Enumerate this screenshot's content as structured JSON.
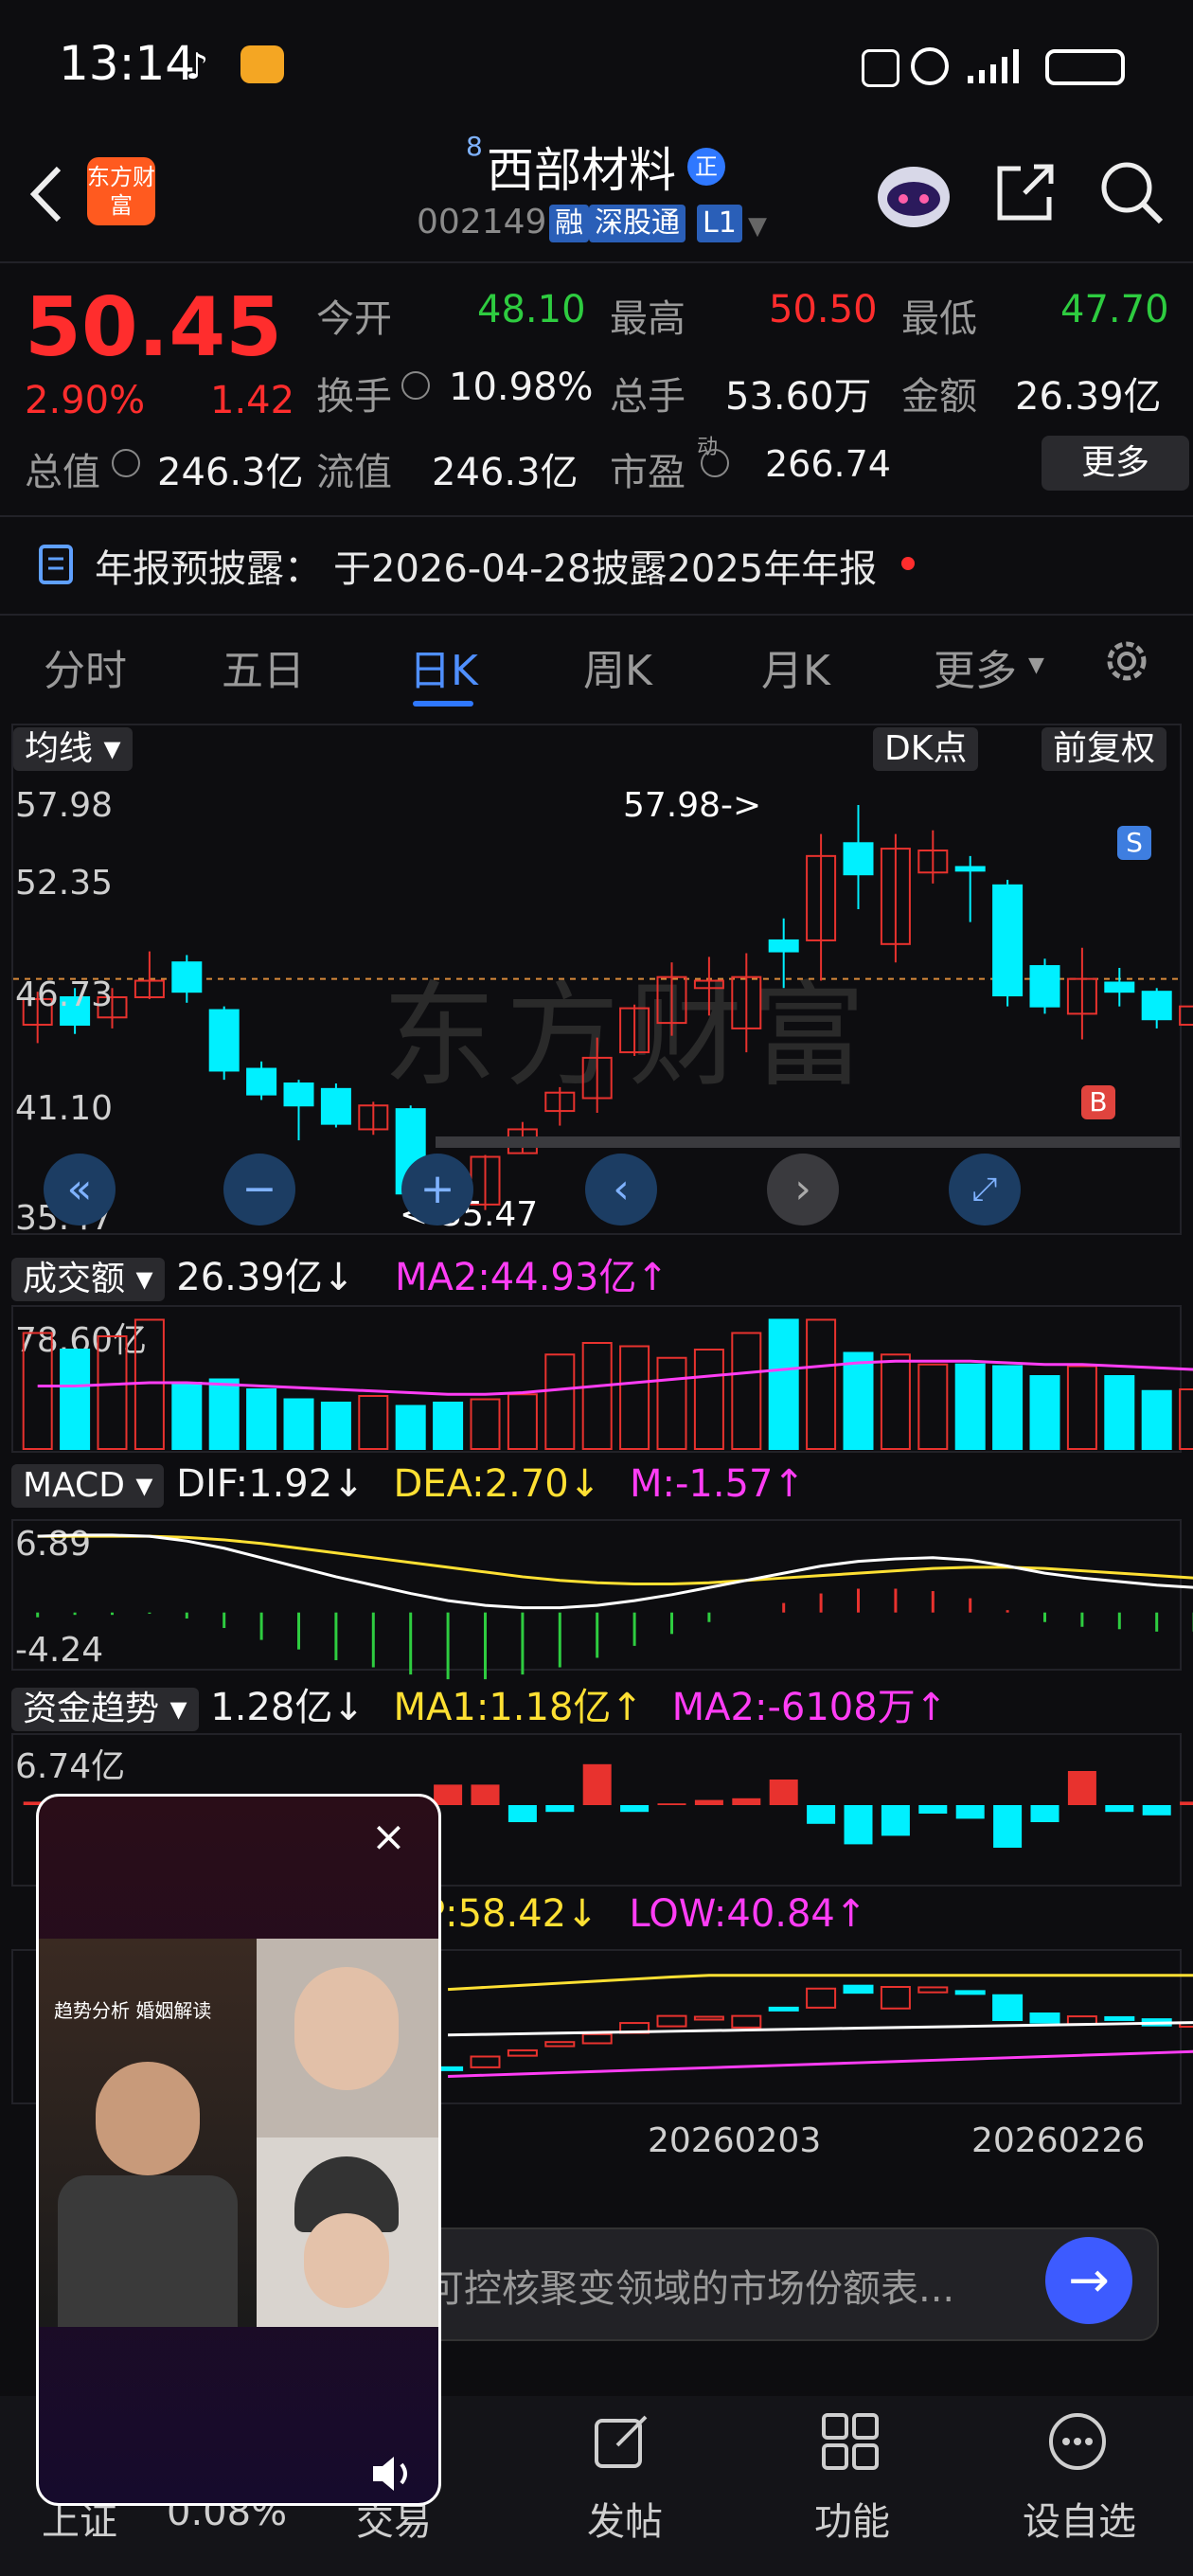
{
  "status_bar": {
    "time": "13:14"
  },
  "header": {
    "stock_name": "西部材料",
    "name_superscript": "8",
    "name_badge": "正",
    "stock_code": "002149",
    "tags": [
      "融",
      "深股通",
      "L1"
    ],
    "logo_text": "东方财富"
  },
  "quote": {
    "price": "50.45",
    "change_pct": "2.90%",
    "change": "1.42",
    "rows": [
      [
        {
          "label": "今开",
          "value": "48.10",
          "color": "green"
        },
        {
          "label": "最高",
          "value": "50.50",
          "color": "red"
        },
        {
          "label": "最低",
          "value": "47.70",
          "color": "green"
        }
      ],
      [
        {
          "label": "换手",
          "value": "10.98%",
          "color": "white"
        },
        {
          "label": "总手",
          "value": "53.60万",
          "color": "white"
        },
        {
          "label": "金额",
          "value": "26.39亿",
          "color": "white"
        }
      ],
      [
        {
          "label": "总值",
          "value": "246.3亿",
          "color": "white"
        },
        {
          "label": "流值",
          "value": "246.3亿",
          "color": "white"
        },
        {
          "label": "市盈",
          "value": "266.74",
          "color": "white"
        }
      ]
    ],
    "pe_sup": "动",
    "more_label": "更多"
  },
  "notice": {
    "label": "年报预披露：",
    "text": "于2026-04-28披露2025年年报"
  },
  "tabs": [
    "分时",
    "五日",
    "日K",
    "周K",
    "月K",
    "更多"
  ],
  "active_tab": "日K",
  "kline": {
    "ma_chip": "均线",
    "dk_chip": "DK点",
    "fq_chip": "前复权",
    "y_labels": [
      "57.98",
      "52.35",
      "46.73",
      "41.10",
      "35.47"
    ],
    "max_label": "57.98->",
    "min_label": "<-35.47",
    "sell_marker": "S",
    "buy_marker": "B",
    "watermark": "东方财富"
  },
  "volume": {
    "name": "成交额",
    "value": "26.39亿↓",
    "ma2": "MA2:44.93亿↑",
    "y_top": "78.60亿"
  },
  "macd": {
    "name": "MACD",
    "dif": "DIF:1.92↓",
    "dea": "DEA:2.70↓",
    "m": "M:-1.57↑",
    "y_top": "6.89",
    "y_bottom": "-4.24"
  },
  "fund": {
    "name": "资金趋势",
    "value": "1.28亿↓",
    "ma1": "MA1:1.18亿↑",
    "ma2": "MA2:-6108万↑",
    "y_top": "6.74亿"
  },
  "band": {
    "up": "P:58.42↓",
    "low": "LOW:40.84↑"
  },
  "x_dates": [
    "20260203",
    "20260226"
  ],
  "ask_bar": {
    "placeholder": "可控核聚变领域的市场份额表..."
  },
  "video": {
    "banner": "趋势分析 婚姻解读"
  },
  "bottom_nav": [
    {
      "label": "上证",
      "value": "0.08%"
    },
    {
      "label": "交易"
    },
    {
      "label": "发帖"
    },
    {
      "label": "功能"
    },
    {
      "label": "设自选"
    }
  ],
  "chart_data": {
    "type": "candlestick",
    "ylim": [
      35.47,
      57.98
    ],
    "candles": [
      {
        "o": 46.0,
        "c": 47.4,
        "h": 47.8,
        "l": 45.0
      },
      {
        "o": 47.5,
        "c": 46.0,
        "h": 48.0,
        "l": 45.5
      },
      {
        "o": 46.4,
        "c": 47.5,
        "h": 48.0,
        "l": 45.8
      },
      {
        "o": 47.5,
        "c": 48.4,
        "h": 50.0,
        "l": 47.4
      },
      {
        "o": 49.4,
        "c": 47.8,
        "h": 49.8,
        "l": 47.2
      },
      {
        "o": 46.8,
        "c": 43.5,
        "h": 47.0,
        "l": 43.0
      },
      {
        "o": 43.6,
        "c": 42.2,
        "h": 44.0,
        "l": 41.9
      },
      {
        "o": 42.8,
        "c": 41.6,
        "h": 43.0,
        "l": 39.7
      },
      {
        "o": 42.5,
        "c": 40.6,
        "h": 42.8,
        "l": 40.4
      },
      {
        "o": 40.3,
        "c": 41.6,
        "h": 41.8,
        "l": 40.0
      },
      {
        "o": 41.4,
        "c": 36.8,
        "h": 41.6,
        "l": 36.5
      },
      {
        "o": 36.2,
        "c": 35.8,
        "h": 36.7,
        "l": 35.47
      },
      {
        "o": 36.2,
        "c": 38.8,
        "h": 38.9,
        "l": 35.9
      },
      {
        "o": 39.0,
        "c": 40.3,
        "h": 40.7,
        "l": 39.0
      },
      {
        "o": 41.3,
        "c": 42.3,
        "h": 42.6,
        "l": 40.5
      },
      {
        "o": 42.0,
        "c": 44.2,
        "h": 45.3,
        "l": 41.2
      },
      {
        "o": 44.5,
        "c": 46.9,
        "h": 47.1,
        "l": 44.3
      },
      {
        "o": 46.1,
        "c": 48.6,
        "h": 49.4,
        "l": 45.4
      },
      {
        "o": 48.0,
        "c": 48.4,
        "h": 49.7,
        "l": 46.5
      },
      {
        "o": 45.8,
        "c": 48.6,
        "h": 49.9,
        "l": 44.5
      },
      {
        "o": 50.6,
        "c": 50.0,
        "h": 51.8,
        "l": 48.0
      },
      {
        "o": 50.6,
        "c": 55.2,
        "h": 56.4,
        "l": 48.4
      },
      {
        "o": 55.9,
        "c": 54.2,
        "h": 57.98,
        "l": 52.3
      },
      {
        "o": 50.4,
        "c": 55.6,
        "h": 56.4,
        "l": 49.4
      },
      {
        "o": 54.3,
        "c": 55.5,
        "h": 56.6,
        "l": 53.7
      },
      {
        "o": 54.6,
        "c": 54.4,
        "h": 55.2,
        "l": 51.6
      },
      {
        "o": 53.6,
        "c": 47.6,
        "h": 53.9,
        "l": 47.0
      },
      {
        "o": 49.2,
        "c": 47.0,
        "h": 49.6,
        "l": 46.6
      },
      {
        "o": 46.6,
        "c": 48.5,
        "h": 50.2,
        "l": 45.2
      },
      {
        "o": 48.3,
        "c": 47.8,
        "h": 49.1,
        "l": 47.0
      },
      {
        "o": 47.8,
        "c": 46.3,
        "h": 48.0,
        "l": 45.8
      },
      {
        "o": 46.0,
        "c": 47.0,
        "h": 47.3,
        "l": 43.0
      },
      {
        "o": 47.0,
        "c": 48.5,
        "h": 48.6,
        "l": 47.0
      }
    ],
    "volume_values": [
      70,
      60,
      68,
      78,
      40,
      42,
      36,
      30,
      28,
      32,
      26,
      28,
      30,
      33,
      57,
      64,
      62,
      55,
      60,
      70,
      78,
      78,
      58,
      57,
      51,
      51,
      50,
      44,
      50,
      44,
      35,
      36,
      35
    ],
    "volume_ma2": [
      38,
      38,
      39,
      40,
      40,
      39,
      38,
      37,
      36,
      35,
      34,
      33,
      33,
      34,
      36,
      38,
      40,
      42,
      44,
      46,
      48,
      50,
      52,
      53,
      53,
      53,
      52,
      51,
      51,
      50,
      49,
      48,
      47
    ],
    "macd_dif": [
      6.4,
      6.5,
      6.5,
      6.4,
      6.0,
      5.4,
      4.6,
      3.8,
      3.0,
      2.3,
      1.6,
      1.0,
      0.6,
      0.4,
      0.4,
      0.6,
      1.0,
      1.5,
      2.1,
      2.7,
      3.3,
      3.9,
      4.3,
      4.5,
      4.6,
      4.4,
      3.9,
      3.3,
      2.9,
      2.6,
      2.3,
      2.1,
      1.92
    ],
    "macd_dea": [
      6.4,
      6.4,
      6.4,
      6.4,
      6.3,
      6.1,
      5.8,
      5.4,
      5.0,
      4.6,
      4.2,
      3.8,
      3.4,
      3.0,
      2.7,
      2.5,
      2.4,
      2.4,
      2.5,
      2.7,
      2.9,
      3.1,
      3.3,
      3.5,
      3.7,
      3.8,
      3.8,
      3.7,
      3.5,
      3.3,
      3.1,
      2.9,
      2.7
    ],
    "macd_m": [
      -0.4,
      -0.2,
      -0.2,
      -0.1,
      -0.5,
      -1.3,
      -2.3,
      -3.1,
      -4.0,
      -4.6,
      -5.2,
      -5.6,
      -5.6,
      -5.2,
      -4.6,
      -3.8,
      -2.8,
      -1.8,
      -0.8,
      0,
      0.8,
      1.6,
      2.0,
      2.0,
      1.8,
      1.2,
      0.2,
      -0.8,
      -1.2,
      -1.4,
      -1.6,
      -1.6,
      -1.57
    ],
    "fund_values": [
      0.2,
      -0.8,
      0.3,
      0.5,
      -1.0,
      -1.8,
      -2.2,
      -1.6,
      -0.6,
      0.3,
      0.4,
      1.2,
      1.2,
      -1.0,
      -0.4,
      2.4,
      -0.4,
      0.1,
      0.3,
      0.4,
      1.5,
      -1.1,
      -2.3,
      -1.8,
      -0.5,
      -0.8,
      -2.5,
      -1.0,
      2.0,
      -0.4,
      -0.6,
      0.2,
      0.3
    ]
  }
}
